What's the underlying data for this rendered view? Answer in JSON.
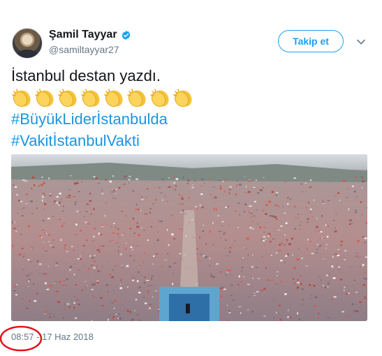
{
  "author": {
    "name": "Şamil Tayyar",
    "handle": "@samiltayyar27"
  },
  "follow_label": "Takip et",
  "tweet": {
    "text_line": "İstanbul destan yazdı.",
    "emoji": "clapping-hands",
    "emoji_count": 8,
    "hashtags": [
      "#BüyükLiderİstanbulda",
      "#VakitİstanbulVakti"
    ]
  },
  "timestamp": "08:57 - 17 Haz 2018",
  "colors": {
    "link": "#1b95e0",
    "follow": "#1da1f2",
    "verified": "#1da1f2",
    "annotation_circle": "#e3121b"
  }
}
